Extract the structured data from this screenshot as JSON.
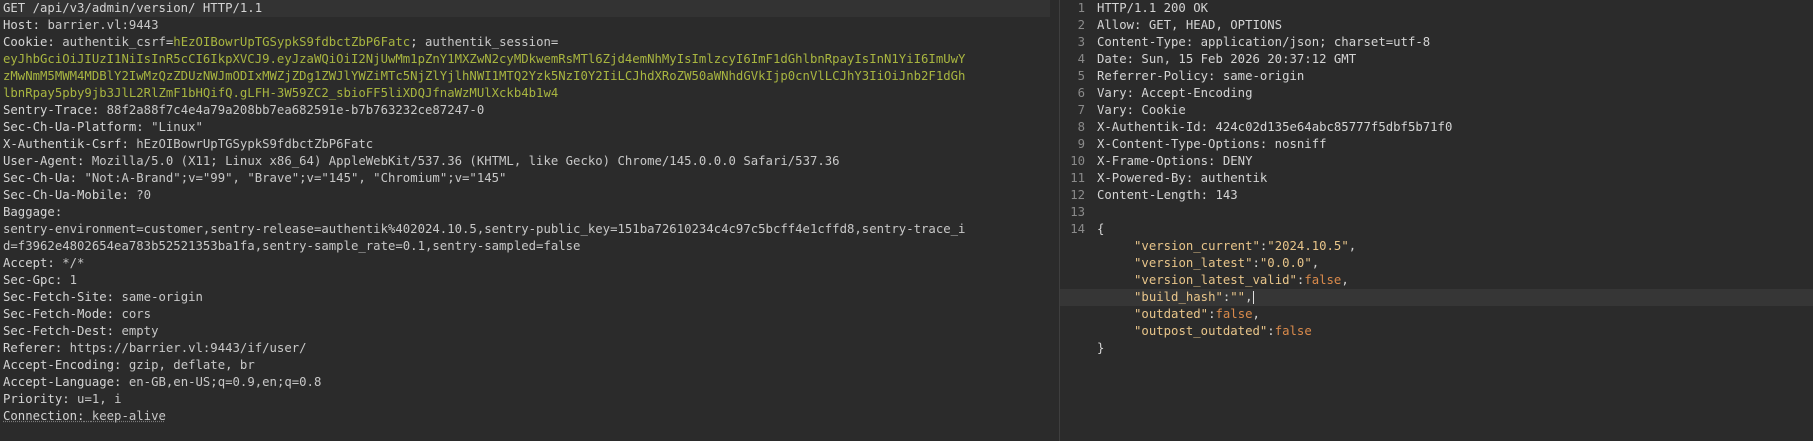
{
  "request": {
    "request_line": "GET /api/v3/admin/version/ HTTP/1.1",
    "host": {
      "key": "Host:",
      "value": "barrier.vl:9443"
    },
    "cookie": {
      "key": "Cookie:",
      "csrf_name": "authentik_csrf",
      "csrf_value": "hEzOIBowrUpTGSypkS9fdbctZbP6Fatc",
      "session_name": "authentik_session",
      "session_value_lines": [
        "eyJhbGciOiJIUzI1NiIsInR5cCI6IkpXVCJ9.eyJzaWQiOiI2NjUwMm1pZnY1MXZwN2cyMDkwemRsMTl6Zjd4emNhMyIsImlzcyI6ImF1dGhlbnRpayIsInN1YiI6ImUwY",
        "zMwNmM5MWM4MDBlY2IwMzQzZDUzNWJmODIxMWZjZDg1ZWJlYWZiMTc5NjZlYjlhNWI1MTQ2Yzk5NzI0Y2IiLCJhdXRoZW50aWNhdGVkIjp0cnVlLCJhY3IiOiJnb2F1dGh",
        "lbnRpay5pby9jb3JlL2RlZmF1bHQifQ.gLFH-3W59ZC2_sbioFF5liXDQJfnaWzMUlXckb4b1w4"
      ]
    },
    "headers_a": [
      {
        "key": "Sentry-Trace:",
        "value": "88f2a88f7c4e4a79a208bb7ea682591e-b7b763232ce87247-0"
      },
      {
        "key": "Sec-Ch-Ua-Platform:",
        "value": "\"Linux\""
      },
      {
        "key": "X-Authentik-Csrf:",
        "value": "hEzOIBowrUpTGSypkS9fdbctZbP6Fatc"
      },
      {
        "key": "User-Agent:",
        "value": "Mozilla/5.0 (X11; Linux x86_64) AppleWebKit/537.36 (KHTML, like Gecko) Chrome/145.0.0.0 Safari/537.36"
      },
      {
        "key": "Sec-Ch-Ua:",
        "value": "\"Not:A-Brand\";v=\"99\", \"Brave\";v=\"145\", \"Chromium\";v=\"145\""
      },
      {
        "key": "Sec-Ch-Ua-Mobile:",
        "value": "?0"
      },
      {
        "key": "Baggage:",
        "value": ""
      }
    ],
    "baggage_lines": [
      "sentry-environment=customer,sentry-release=authentik%402024.10.5,sentry-public_key=151ba72610234c4c97c5bcff4e1cffd8,sentry-trace_i",
      "d=f3962e4802654ea783b52521353ba1fa,sentry-sample_rate=0.1,sentry-sampled=false"
    ],
    "headers_b": [
      {
        "key": "Accept:",
        "value": "*/*"
      },
      {
        "key": "Sec-Gpc:",
        "value": "1"
      },
      {
        "key": "Sec-Fetch-Site:",
        "value": "same-origin"
      },
      {
        "key": "Sec-Fetch-Mode:",
        "value": "cors"
      },
      {
        "key": "Sec-Fetch-Dest:",
        "value": "empty"
      },
      {
        "key": "Referer:",
        "value": "https://barrier.vl:9443/if/user/"
      },
      {
        "key": "Accept-Encoding:",
        "value": "gzip, deflate, br"
      },
      {
        "key": "Accept-Language:",
        "value": "en-GB,en-US;q=0.9,en;q=0.8"
      },
      {
        "key": "Priority:",
        "value": "u=1, i"
      }
    ],
    "connection": {
      "key": "Connection:",
      "value": "keep-alive"
    }
  },
  "response": {
    "lines": [
      {
        "num": "1",
        "text": "HTTP/1.1 200 OK"
      },
      {
        "num": "2",
        "text": "Allow: GET, HEAD, OPTIONS"
      },
      {
        "num": "3",
        "text": "Content-Type: application/json; charset=utf-8"
      },
      {
        "num": "4",
        "text": "Date: Sun, 15 Feb 2026 20:37:12 GMT"
      },
      {
        "num": "5",
        "text": "Referrer-Policy: same-origin"
      },
      {
        "num": "6",
        "text": "Vary: Accept-Encoding"
      },
      {
        "num": "7",
        "text": "Vary: Cookie"
      },
      {
        "num": "8",
        "text": "X-Authentik-Id: 424c02d135e64abc85777f5dbf5b71f0"
      },
      {
        "num": "9",
        "text": "X-Content-Type-Options: nosniff"
      },
      {
        "num": "10",
        "text": "X-Frame-Options: DENY"
      },
      {
        "num": "11",
        "text": "X-Powered-By: authentik"
      },
      {
        "num": "12",
        "text": "Content-Length: 143"
      },
      {
        "num": "13",
        "text": ""
      },
      {
        "num": "14",
        "text": "{"
      }
    ],
    "json": [
      {
        "key": "\"version_current\"",
        "value": "\"2024.10.5\"",
        "kind": "str",
        "comma": ","
      },
      {
        "key": "\"version_latest\"",
        "value": "\"0.0.0\"",
        "kind": "str",
        "comma": ","
      },
      {
        "key": "\"version_latest_valid\"",
        "value": "false",
        "kind": "bool",
        "comma": ","
      },
      {
        "key": "\"build_hash\"",
        "value": "\"\"",
        "kind": "str",
        "comma": ","
      },
      {
        "key": "\"outdated\"",
        "value": "false",
        "kind": "bool",
        "comma": ","
      },
      {
        "key": "\"outpost_outdated\"",
        "value": "false",
        "kind": "bool",
        "comma": ""
      }
    ],
    "closing": "}"
  }
}
